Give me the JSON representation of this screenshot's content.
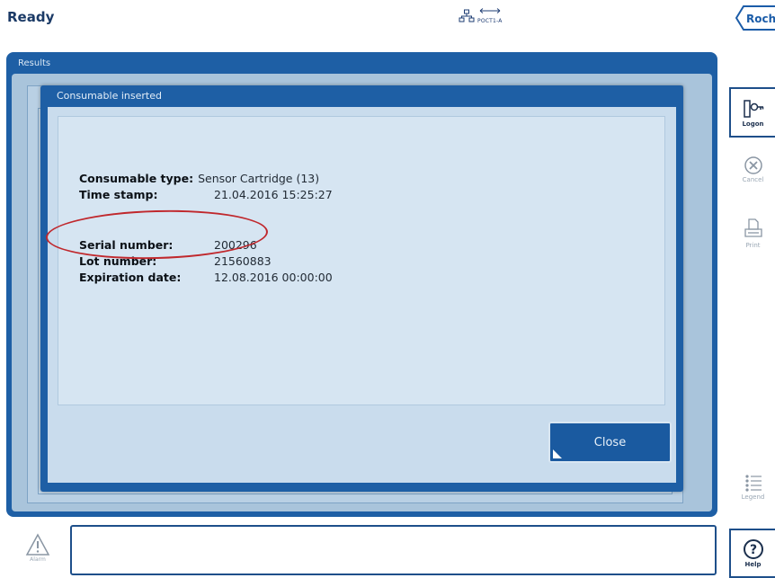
{
  "status": {
    "text": "Ready"
  },
  "network": {
    "label": "POCT1-A"
  },
  "brand": {
    "logo": "Roche"
  },
  "screen": {
    "title": "Results"
  },
  "dialog": {
    "title": "Consumable inserted",
    "rows": [
      {
        "label": "Consumable type:",
        "value": "Sensor Cartridge (13)"
      },
      {
        "label": "Time stamp:",
        "value": "21.04.2016 15:25:27"
      },
      {
        "label": "Serial number:",
        "value": "200296"
      },
      {
        "label": "Lot number:",
        "value": "21560883"
      },
      {
        "label": "Expiration date:",
        "value": "12.08.2016 00:00:00"
      }
    ],
    "close_label": "Close"
  },
  "sidebar": {
    "logon": {
      "label": "Logon",
      "icon": "key-icon"
    },
    "cancel": {
      "label": "Cancel",
      "icon": "cancel-circle-icon"
    },
    "print": {
      "label": "Print",
      "icon": "printer-icon"
    },
    "legend": {
      "label": "Legend",
      "icon": "legend-list-icon"
    },
    "help": {
      "label": "Help",
      "icon": "help-circle-icon"
    }
  },
  "bottom": {
    "alarm": {
      "label": "Alarm",
      "icon": "warning-triangle-icon"
    },
    "message": ""
  },
  "colors": {
    "frame_blue": "#1e5fa5",
    "panel_light": "#d6e5f2",
    "annotation_red": "#c0282d"
  }
}
